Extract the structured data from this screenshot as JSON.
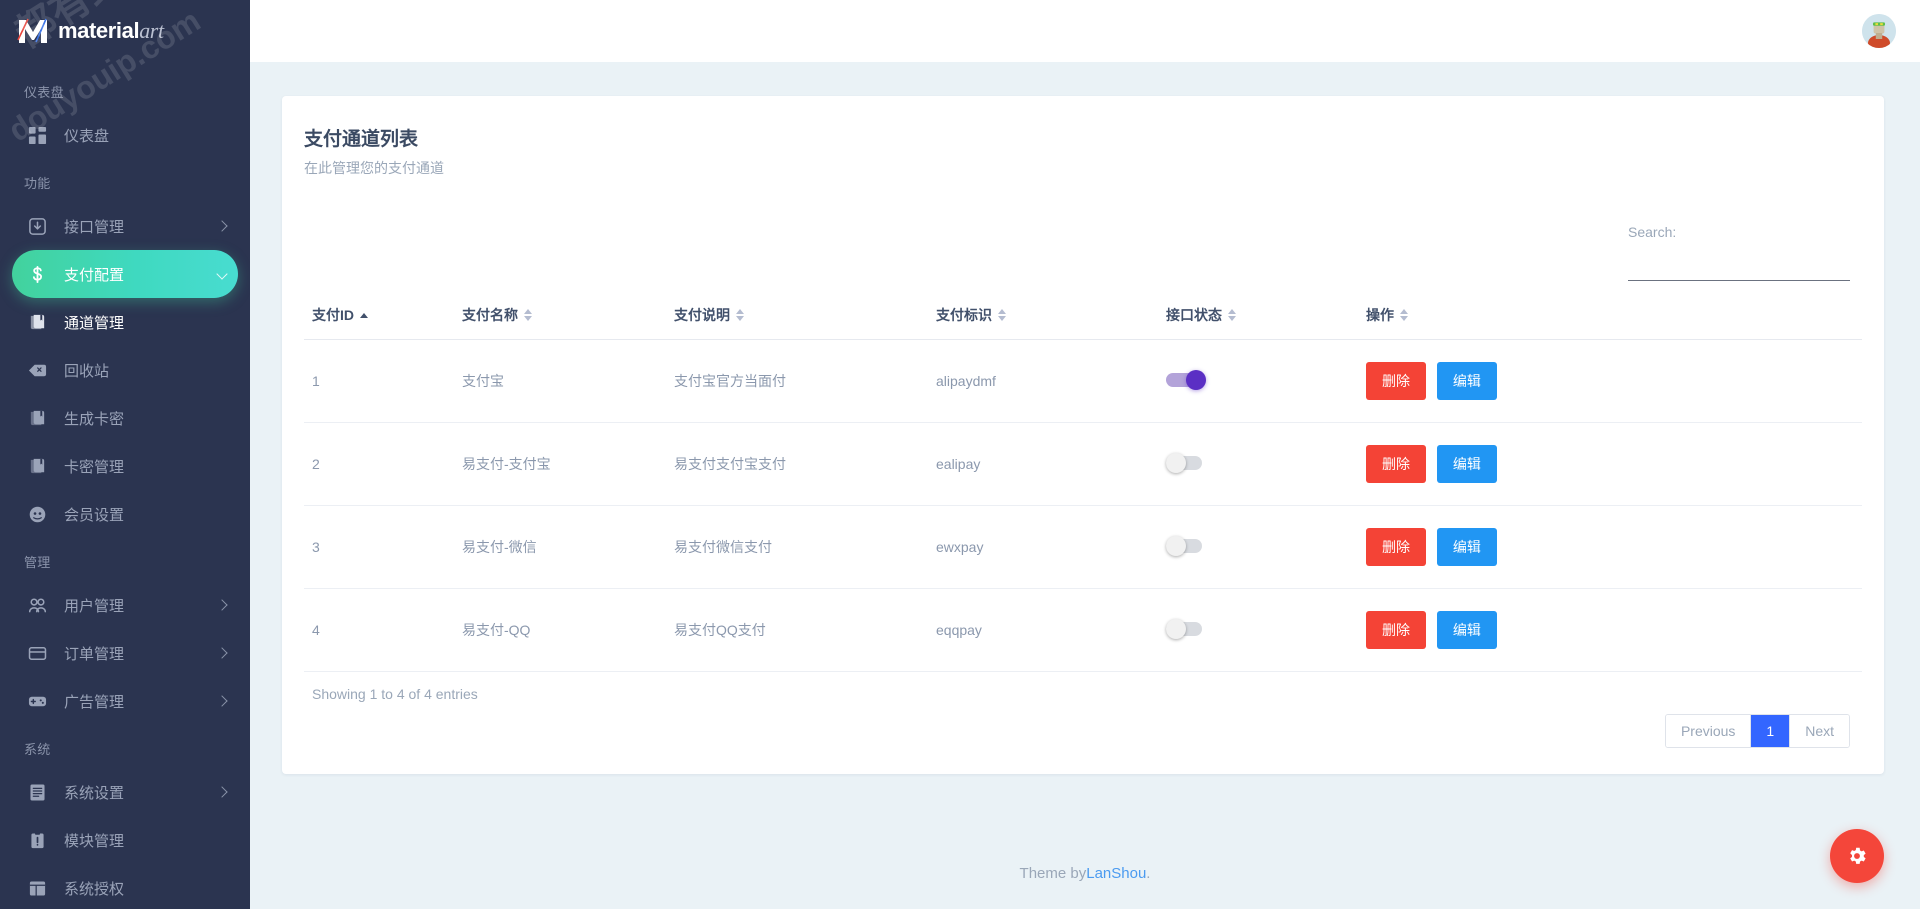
{
  "brand": {
    "name_bold": "material",
    "name_italic": "art",
    "mark_icon": "m-logo-icon"
  },
  "watermark": {
    "line1": "都有综合资源网",
    "line2": "douyouip.com"
  },
  "sidebar": {
    "sections": [
      {
        "title": "仪表盘",
        "items": [
          {
            "label": "仪表盘",
            "icon": "dashboard-grid-icon",
            "state": "normal",
            "expandable": false
          }
        ]
      },
      {
        "title": "功能",
        "items": [
          {
            "label": "接口管理",
            "icon": "download-box-icon",
            "state": "normal",
            "expandable": true
          },
          {
            "label": "支付配置",
            "icon": "dollar-icon",
            "state": "active",
            "expandable": true
          },
          {
            "label": "通道管理",
            "icon": "book-icon",
            "state": "current",
            "expandable": false
          },
          {
            "label": "回收站",
            "icon": "delete-box-icon",
            "state": "normal",
            "expandable": false
          },
          {
            "label": "生成卡密",
            "icon": "book-icon",
            "state": "normal",
            "expandable": false
          },
          {
            "label": "卡密管理",
            "icon": "book-icon",
            "state": "normal",
            "expandable": false
          },
          {
            "label": "会员设置",
            "icon": "user-circle-icon",
            "state": "normal",
            "expandable": false
          }
        ]
      },
      {
        "title": "管理",
        "items": [
          {
            "label": "用户管理",
            "icon": "users-icon",
            "state": "normal",
            "expandable": true
          },
          {
            "label": "订单管理",
            "icon": "credit-card-icon",
            "state": "normal",
            "expandable": true
          },
          {
            "label": "广告管理",
            "icon": "gamepad-icon",
            "state": "normal",
            "expandable": true
          }
        ]
      },
      {
        "title": "系统",
        "items": [
          {
            "label": "系统设置",
            "icon": "list-doc-icon",
            "state": "normal",
            "expandable": true
          },
          {
            "label": "模块管理",
            "icon": "clipboard-alert-icon",
            "state": "normal",
            "expandable": false
          },
          {
            "label": "系统授权",
            "icon": "window-layout-icon",
            "state": "normal",
            "expandable": false
          }
        ]
      }
    ]
  },
  "topbar": {
    "avatar_icon": "user-avatar-icon"
  },
  "page": {
    "title": "支付通道列表",
    "subtitle": "在此管理您的支付通道"
  },
  "search": {
    "label": "Search:",
    "value": "",
    "placeholder": ""
  },
  "table": {
    "columns": [
      {
        "label": "支付ID",
        "sort": "asc"
      },
      {
        "label": "支付名称",
        "sort": "none"
      },
      {
        "label": "支付说明",
        "sort": "none"
      },
      {
        "label": "支付标识",
        "sort": "none"
      },
      {
        "label": "接口状态",
        "sort": "none"
      },
      {
        "label": "操作",
        "sort": "none"
      }
    ],
    "rows": [
      {
        "id": "1",
        "name": "支付宝",
        "desc": "支付宝官方当面付",
        "ident": "alipaydmf",
        "enabled": true,
        "delete_label": "删除",
        "edit_label": "编辑"
      },
      {
        "id": "2",
        "name": "易支付-支付宝",
        "desc": "易支付支付宝支付",
        "ident": "ealipay",
        "enabled": false,
        "delete_label": "删除",
        "edit_label": "编辑"
      },
      {
        "id": "3",
        "name": "易支付-微信",
        "desc": "易支付微信支付",
        "ident": "ewxpay",
        "enabled": false,
        "delete_label": "删除",
        "edit_label": "编辑"
      },
      {
        "id": "4",
        "name": "易支付-QQ",
        "desc": "易支付QQ支付",
        "ident": "eqqpay",
        "enabled": false,
        "delete_label": "删除",
        "edit_label": "编辑"
      }
    ],
    "info": "Showing 1 to 4 of 4 entries"
  },
  "pagination": {
    "previous": "Previous",
    "pages": [
      "1"
    ],
    "current": "1",
    "next": "Next"
  },
  "footer": {
    "prefix": "Theme by ",
    "link": "LanShou",
    "suffix": "."
  },
  "fab": {
    "icon": "gear-icon"
  },
  "colors": {
    "sidebar_bg": "#2b3450",
    "accent_active": "#42d29d",
    "delete_btn": "#f44336",
    "edit_btn": "#2196f3",
    "toggle_on": "#5b2fc4",
    "pagination_active": "#3366ff",
    "fab_bg": "#f4463a",
    "content_bg": "#eaf2f6"
  }
}
